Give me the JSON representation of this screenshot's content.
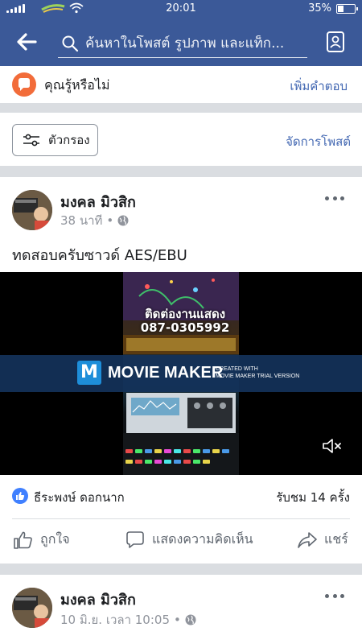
{
  "status_bar": {
    "time": "20:01",
    "battery": "35%",
    "battery_level": 0.35
  },
  "search": {
    "placeholder": "ค้นหาในโพสต์ รูปภาพ และแท็ก..."
  },
  "did_you_know": {
    "label": "คุณรู้หรือไม่",
    "action": "เพิ่มคำตอบ"
  },
  "filter_bar": {
    "filter_label": "ตัวกรอง",
    "manage_label": "จัดการโพสต์"
  },
  "posts": [
    {
      "author": "มงคล มิวสิก",
      "time": "38 นาที",
      "text": "ทดสอบครับซาวด์ AES/EBU",
      "video": {
        "overlay_line1": "ติดต่องานแสดง",
        "overlay_line2": "087-0305992",
        "watermark_title": "MOVIE MAKER",
        "watermark_sub_line1": "CREATED WITH",
        "watermark_sub_line2": "MOVIE MAKER TRIAL VERSION"
      },
      "reactor": "ธีระพงษ์ ดอกนาก",
      "views": "รับชม 14 ครั้ง"
    },
    {
      "author": "มงคล มิวสิก",
      "time": "10 มิ.ย. เวลา 10:05"
    }
  ],
  "actions": {
    "like": "ถูกใจ",
    "comment": "แสดงความคิดเห็น",
    "share": "แชร์"
  },
  "colors": {
    "brand": "#3b5998",
    "link": "#4267b2",
    "like": "#4080ff",
    "dyk_badge": "#f26c3a"
  }
}
